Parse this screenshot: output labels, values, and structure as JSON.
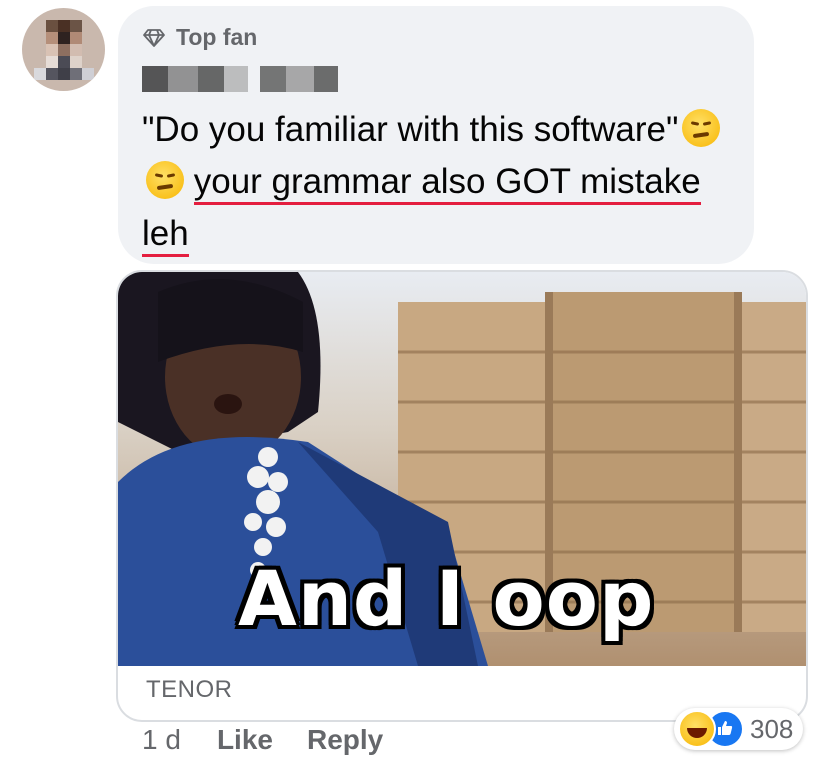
{
  "badge": {
    "label": "Top fan",
    "icon": "diamond-icon"
  },
  "comment": {
    "text_plain": "\"Do you familiar with this software\"",
    "text_underlined": "your grammar also GOT mistake leh",
    "emoji": "woozy-face-icon"
  },
  "gif": {
    "caption": "And I oop",
    "provider": "TENOR"
  },
  "actions": {
    "time": "1 d",
    "like": "Like",
    "reply": "Reply"
  },
  "reactions": {
    "icons": [
      "haha-icon",
      "like-icon"
    ],
    "count": "308"
  },
  "colors": {
    "bubble": "#f0f2f5",
    "underline": "#e41e3f",
    "like_blue": "#1877f2",
    "secondary_text": "#65676b"
  }
}
